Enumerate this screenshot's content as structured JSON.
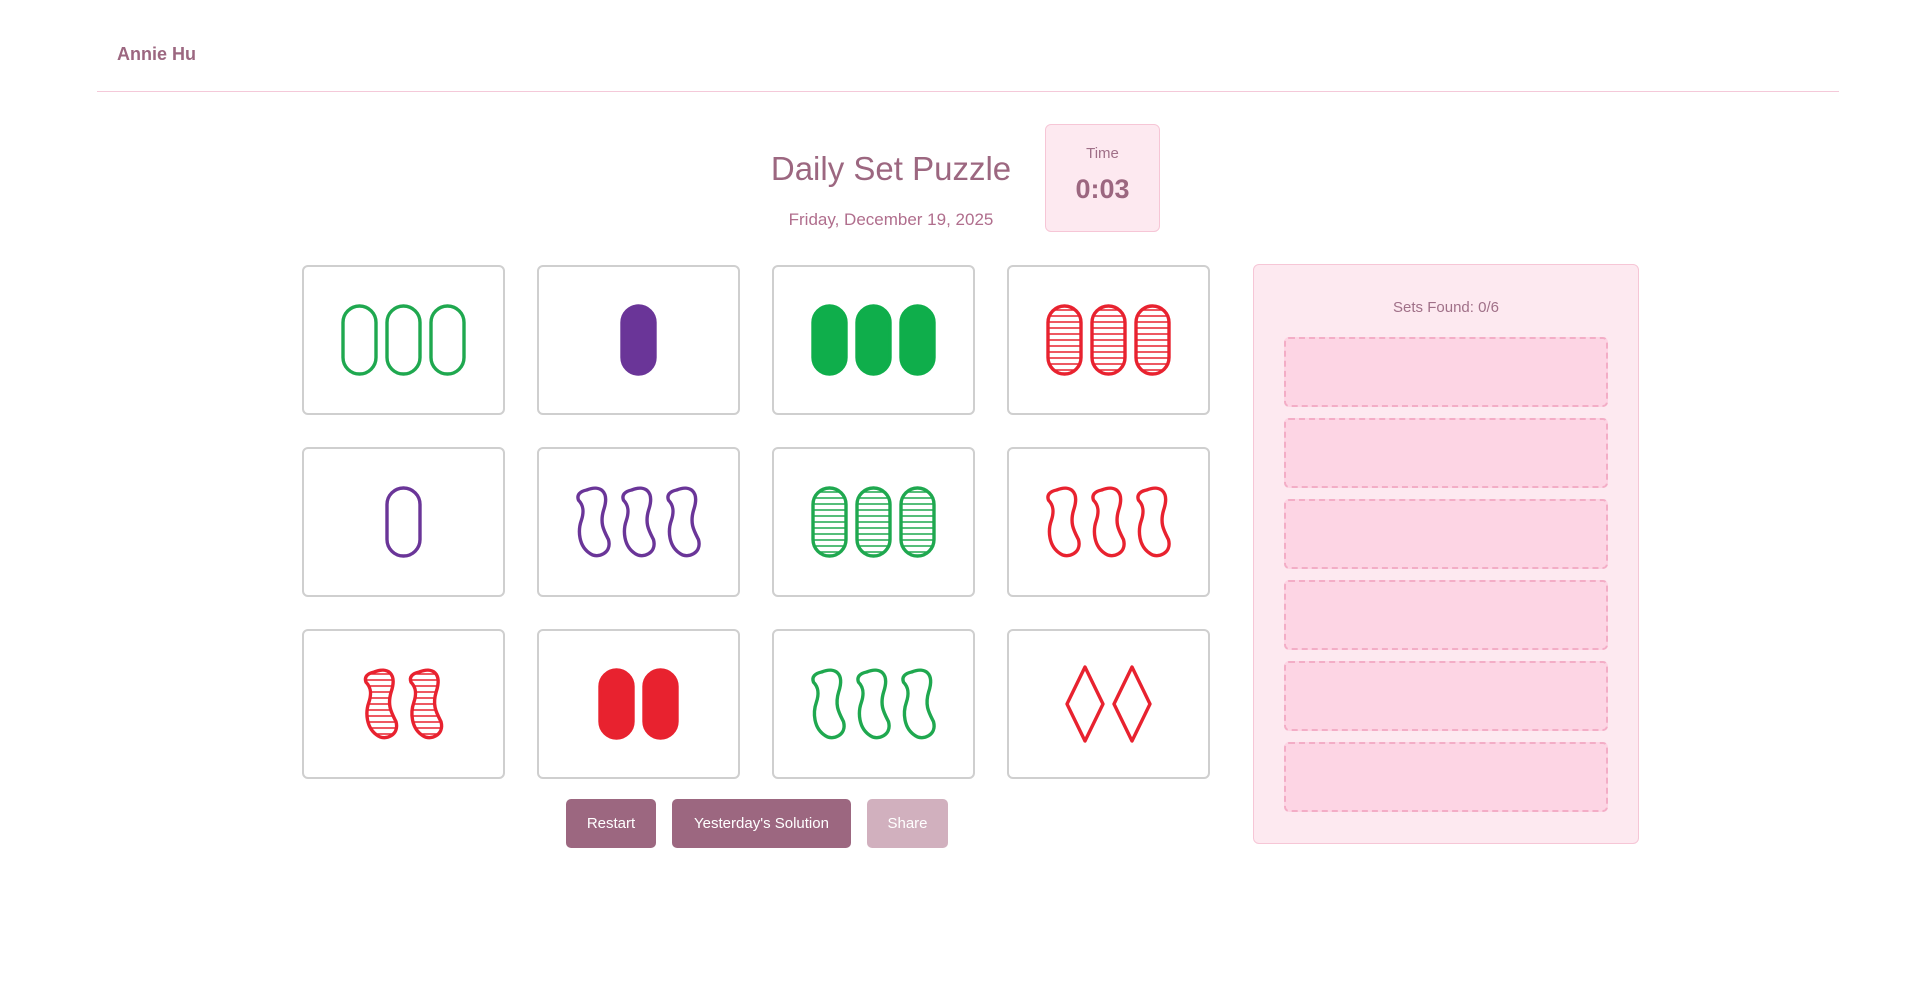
{
  "header": {
    "brand": "Annie Hu"
  },
  "puzzle": {
    "title": "Daily Set Puzzle",
    "date": "Friday, December 19, 2025"
  },
  "timer": {
    "label": "Time",
    "value": "0:03"
  },
  "colors": {
    "green": "#1fa84f",
    "purple": "#6a3598",
    "red": "#e8222f",
    "solid_green": "#0fae4b",
    "accent": "#9c6780"
  },
  "cards": [
    {
      "count": 3,
      "shape": "oval",
      "fill": "empty",
      "color": "green"
    },
    {
      "count": 1,
      "shape": "oval",
      "fill": "solid",
      "color": "purple"
    },
    {
      "count": 3,
      "shape": "oval",
      "fill": "solid",
      "color": "solid_green"
    },
    {
      "count": 3,
      "shape": "oval",
      "fill": "striped",
      "color": "red"
    },
    {
      "count": 1,
      "shape": "oval",
      "fill": "empty",
      "color": "purple"
    },
    {
      "count": 3,
      "shape": "squiggle",
      "fill": "empty",
      "color": "purple"
    },
    {
      "count": 3,
      "shape": "oval",
      "fill": "striped",
      "color": "green"
    },
    {
      "count": 3,
      "shape": "squiggle",
      "fill": "empty",
      "color": "red"
    },
    {
      "count": 2,
      "shape": "squiggle",
      "fill": "striped",
      "color": "red"
    },
    {
      "count": 2,
      "shape": "oval",
      "fill": "solid",
      "color": "red"
    },
    {
      "count": 3,
      "shape": "squiggle",
      "fill": "empty",
      "color": "green"
    },
    {
      "count": 2,
      "shape": "diamond",
      "fill": "empty",
      "color": "red"
    }
  ],
  "buttons": {
    "restart": "Restart",
    "yesterday": "Yesterday's Solution",
    "share": "Share"
  },
  "sets_panel": {
    "found_label": "Sets Found: 0/6",
    "slot_count": 6
  }
}
